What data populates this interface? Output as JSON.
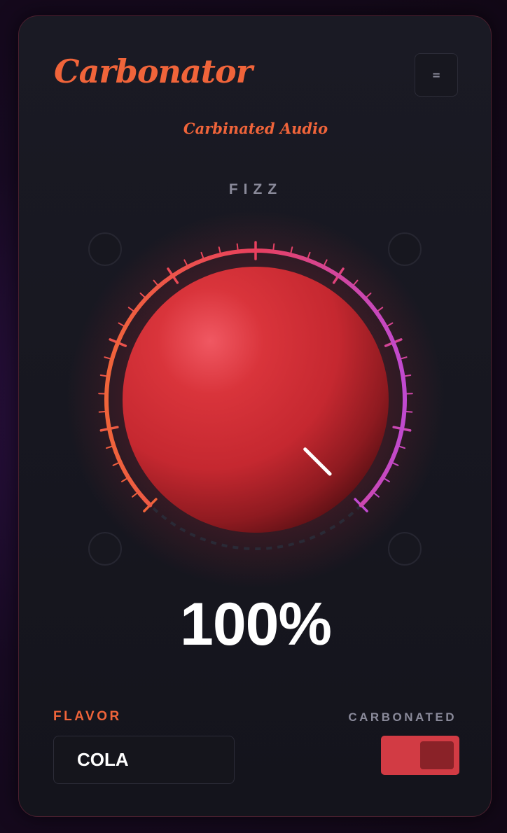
{
  "app": {
    "title": "Carbonator",
    "subtitle": "Carbinated Audio",
    "menu_icon": "="
  },
  "knob": {
    "label": "FIZZ",
    "value_text": "100%",
    "value_fraction": 1.0,
    "arc_colors": [
      "#f0643a",
      "#e8405e",
      "#c04ad0"
    ],
    "knob_color": "#d12f36"
  },
  "flavor": {
    "label": "FLAVOR",
    "selected": "COLA"
  },
  "carbonated": {
    "label": "CARBONATED",
    "on": true,
    "color": "#d23b44"
  },
  "colors": {
    "accent": "#f0643a",
    "muted": "#8a8a9a",
    "panel": "#16161e"
  }
}
